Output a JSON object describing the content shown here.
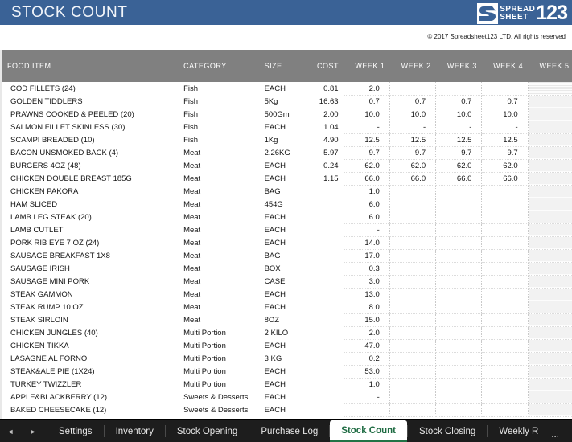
{
  "banner": {
    "title": "STOCK COUNT",
    "logo": {
      "line1": "SPREAD",
      "line2": "SHEET",
      "number": "123",
      "mark": "s-logo-mark"
    },
    "accent_color": "#3A6296"
  },
  "copyright": {
    "text": "© 2017 Spreadsheet123 LTD. All rights reserved"
  },
  "table": {
    "header_color": "#808080",
    "columns": [
      "FOOD ITEM",
      "CATEGORY",
      "SIZE",
      "COST",
      "WEEK 1",
      "WEEK 2",
      "WEEK 3",
      "WEEK 4",
      "WEEK 5"
    ],
    "rows": [
      {
        "food": "COD FILLETS (24)",
        "category": "Fish",
        "size": "EACH",
        "cost": "0.81",
        "w1": "2.0",
        "w2": "",
        "w3": "",
        "w4": "",
        "w5": ""
      },
      {
        "food": "GOLDEN TIDDLERS",
        "category": "Fish",
        "size": "5Kg",
        "cost": "16.63",
        "w1": "0.7",
        "w2": "0.7",
        "w3": "0.7",
        "w4": "0.7",
        "w5": ""
      },
      {
        "food": "PRAWNS COOKED & PEELED (20)",
        "category": "Fish",
        "size": "500Gm",
        "cost": "2.00",
        "w1": "10.0",
        "w2": "10.0",
        "w3": "10.0",
        "w4": "10.0",
        "w5": ""
      },
      {
        "food": "SALMON FILLET SKINLESS (30)",
        "category": "Fish",
        "size": "EACH",
        "cost": "1.04",
        "w1": "-",
        "w2": "-",
        "w3": "-",
        "w4": "-",
        "w5": ""
      },
      {
        "food": "SCAMPI BREADED (10)",
        "category": "Fish",
        "size": "1Kg",
        "cost": "4.90",
        "w1": "12.5",
        "w2": "12.5",
        "w3": "12.5",
        "w4": "12.5",
        "w5": ""
      },
      {
        "food": "BACON UNSMOKED BACK (4)",
        "category": "Meat",
        "size": "2.26KG",
        "cost": "5.97",
        "w1": "9.7",
        "w2": "9.7",
        "w3": "9.7",
        "w4": "9.7",
        "w5": ""
      },
      {
        "food": "BURGERS 4OZ (48)",
        "category": "Meat",
        "size": "EACH",
        "cost": "0.24",
        "w1": "62.0",
        "w2": "62.0",
        "w3": "62.0",
        "w4": "62.0",
        "w5": ""
      },
      {
        "food": "CHICKEN DOUBLE BREAST 185G",
        "category": "Meat",
        "size": "EACH",
        "cost": "1.15",
        "w1": "66.0",
        "w2": "66.0",
        "w3": "66.0",
        "w4": "66.0",
        "w5": ""
      },
      {
        "food": "CHICKEN PAKORA",
        "category": "Meat",
        "size": "BAG",
        "cost": "",
        "w1": "1.0",
        "w2": "",
        "w3": "",
        "w4": "",
        "w5": ""
      },
      {
        "food": "HAM SLICED",
        "category": "Meat",
        "size": "454G",
        "cost": "",
        "w1": "6.0",
        "w2": "",
        "w3": "",
        "w4": "",
        "w5": ""
      },
      {
        "food": "LAMB LEG STEAK (20)",
        "category": "Meat",
        "size": "EACH",
        "cost": "",
        "w1": "6.0",
        "w2": "",
        "w3": "",
        "w4": "",
        "w5": ""
      },
      {
        "food": "LAMB CUTLET",
        "category": "Meat",
        "size": "EACH",
        "cost": "",
        "w1": "-",
        "w2": "",
        "w3": "",
        "w4": "",
        "w5": ""
      },
      {
        "food": "PORK RIB EYE 7 OZ (24)",
        "category": "Meat",
        "size": "EACH",
        "cost": "",
        "w1": "14.0",
        "w2": "",
        "w3": "",
        "w4": "",
        "w5": ""
      },
      {
        "food": "SAUSAGE BREAKFAST 1X8",
        "category": "Meat",
        "size": "BAG",
        "cost": "",
        "w1": "17.0",
        "w2": "",
        "w3": "",
        "w4": "",
        "w5": ""
      },
      {
        "food": "SAUSAGE IRISH",
        "category": "Meat",
        "size": "BOX",
        "cost": "",
        "w1": "0.3",
        "w2": "",
        "w3": "",
        "w4": "",
        "w5": ""
      },
      {
        "food": "SAUSAGE MINI PORK",
        "category": "Meat",
        "size": "CASE",
        "cost": "",
        "w1": "3.0",
        "w2": "",
        "w3": "",
        "w4": "",
        "w5": ""
      },
      {
        "food": "STEAK GAMMON",
        "category": "Meat",
        "size": "EACH",
        "cost": "",
        "w1": "13.0",
        "w2": "",
        "w3": "",
        "w4": "",
        "w5": ""
      },
      {
        "food": "STEAK RUMP 10 OZ",
        "category": "Meat",
        "size": "EACH",
        "cost": "",
        "w1": "8.0",
        "w2": "",
        "w3": "",
        "w4": "",
        "w5": ""
      },
      {
        "food": "STEAK SIRLOIN",
        "category": "Meat",
        "size": "8OZ",
        "cost": "",
        "w1": "15.0",
        "w2": "",
        "w3": "",
        "w4": "",
        "w5": ""
      },
      {
        "food": "CHICKEN JUNGLES (40)",
        "category": "Multi Portion",
        "size": "2 KILO",
        "cost": "",
        "w1": "2.0",
        "w2": "",
        "w3": "",
        "w4": "",
        "w5": ""
      },
      {
        "food": "CHICKEN TIKKA",
        "category": "Multi Portion",
        "size": "EACH",
        "cost": "",
        "w1": "47.0",
        "w2": "",
        "w3": "",
        "w4": "",
        "w5": ""
      },
      {
        "food": "LASAGNE AL FORNO",
        "category": "Multi Portion",
        "size": "3 KG",
        "cost": "",
        "w1": "0.2",
        "w2": "",
        "w3": "",
        "w4": "",
        "w5": ""
      },
      {
        "food": "STEAK&ALE PIE (1X24)",
        "category": "Multi Portion",
        "size": "EACH",
        "cost": "",
        "w1": "53.0",
        "w2": "",
        "w3": "",
        "w4": "",
        "w5": ""
      },
      {
        "food": "TURKEY TWIZZLER",
        "category": "Multi Portion",
        "size": "EACH",
        "cost": "",
        "w1": "1.0",
        "w2": "",
        "w3": "",
        "w4": "",
        "w5": ""
      },
      {
        "food": "APPLE&BLACKBERRY (12)",
        "category": "Sweets & Desserts",
        "size": "EACH",
        "cost": "",
        "w1": "-",
        "w2": "",
        "w3": "",
        "w4": "",
        "w5": ""
      },
      {
        "food": "BAKED CHEESECAKE (12)",
        "category": "Sweets & Desserts",
        "size": "EACH",
        "cost": "",
        "w1": "",
        "w2": "",
        "w3": "",
        "w4": "",
        "w5": ""
      }
    ]
  },
  "tabbar": {
    "prev_icon": "◄",
    "next_icon": "►",
    "active_color": "#217346",
    "tabs": [
      {
        "label": "Settings",
        "active": false
      },
      {
        "label": "Inventory",
        "active": false
      },
      {
        "label": "Stock Opening",
        "active": false
      },
      {
        "label": "Purchase Log",
        "active": false
      },
      {
        "label": "Stock Count",
        "active": true
      },
      {
        "label": "Stock Closing",
        "active": false
      },
      {
        "label": "Weekly R",
        "active": false
      }
    ],
    "overflow_label": "..."
  }
}
